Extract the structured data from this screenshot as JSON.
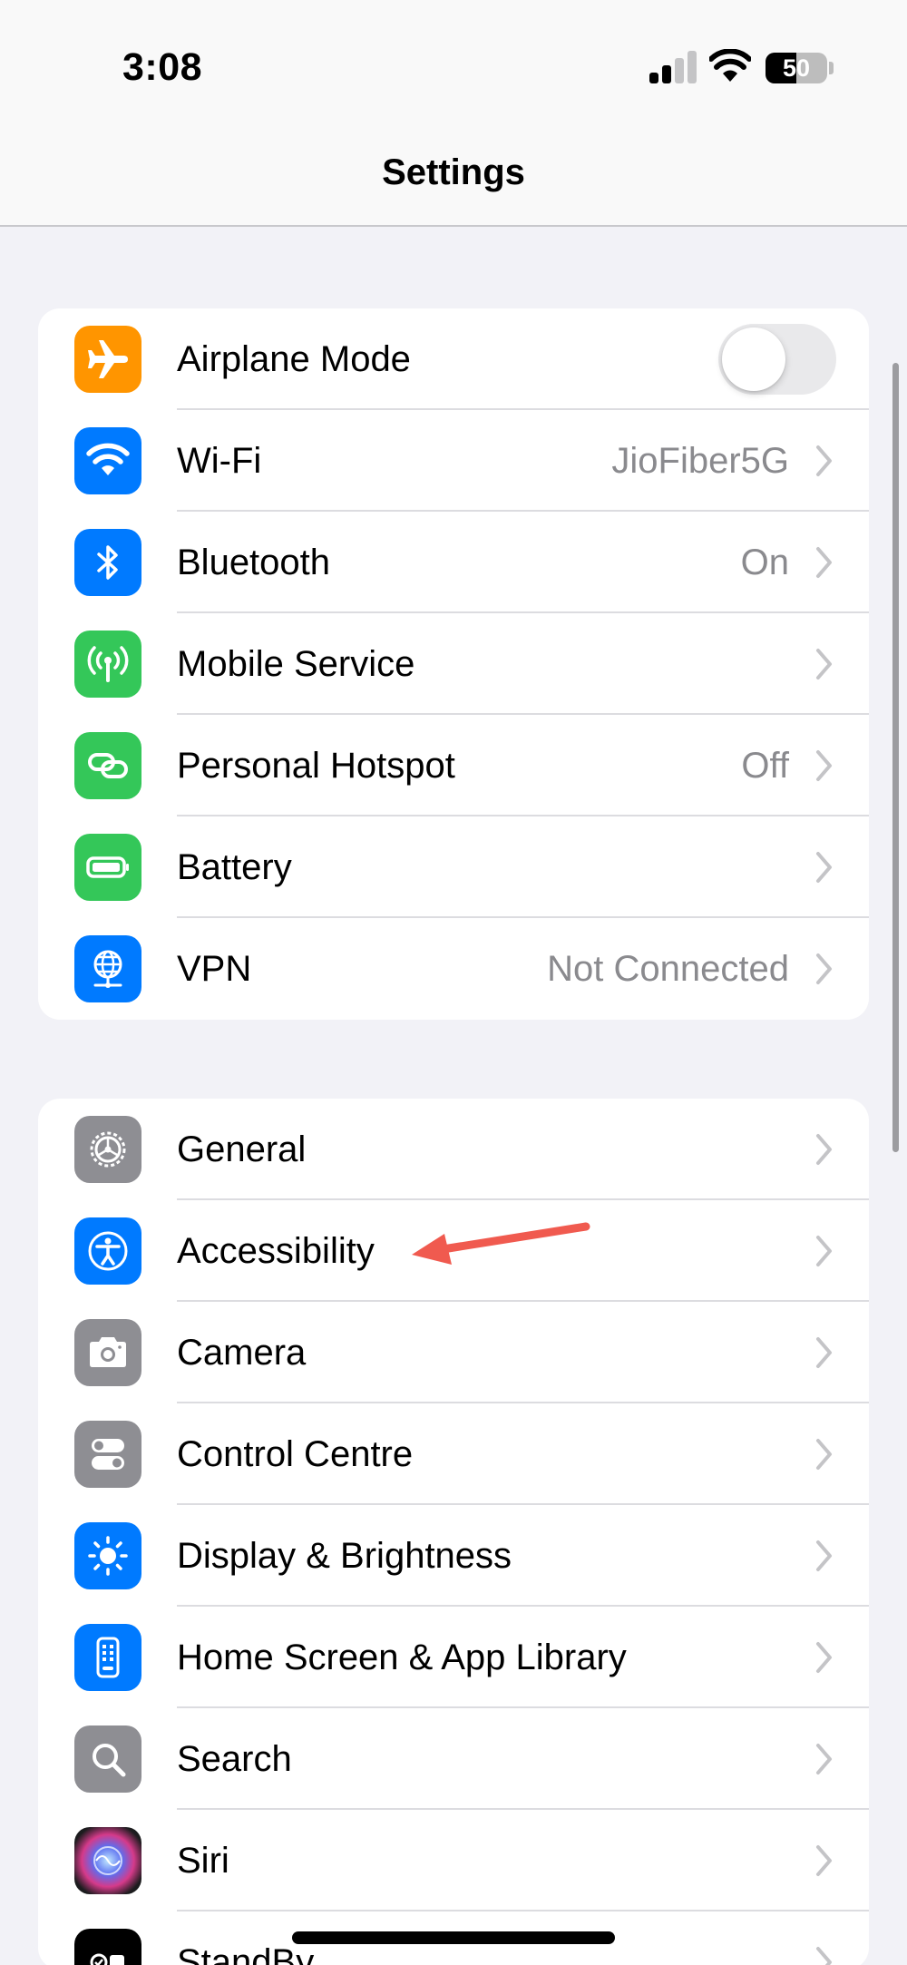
{
  "status_bar": {
    "time": "3:08",
    "battery_percent": "50",
    "battery_level": 0.5,
    "icons": [
      "cellular-signal-icon",
      "wifi-icon",
      "battery-icon"
    ]
  },
  "nav": {
    "title": "Settings"
  },
  "group1": {
    "airplane": {
      "label": "Airplane Mode",
      "toggle_on": false,
      "icon": "airplane-icon",
      "color": "#ff9500"
    },
    "wifi": {
      "label": "Wi-Fi",
      "value": "JioFiber5G",
      "icon": "wifi-icon",
      "color": "#007aff"
    },
    "bluetooth": {
      "label": "Bluetooth",
      "value": "On",
      "icon": "bluetooth-icon",
      "color": "#007aff"
    },
    "mobile": {
      "label": "Mobile Service",
      "icon": "antenna-icon",
      "color": "#34c759"
    },
    "hotspot": {
      "label": "Personal Hotspot",
      "value": "Off",
      "icon": "link-icon",
      "color": "#34c759"
    },
    "battery": {
      "label": "Battery",
      "icon": "battery-icon",
      "color": "#34c759"
    },
    "vpn": {
      "label": "VPN",
      "value": "Not Connected",
      "icon": "globe-icon",
      "color": "#007aff"
    }
  },
  "group2": {
    "general": {
      "label": "General",
      "icon": "gear-icon",
      "color": "#8e8e93"
    },
    "accessibility": {
      "label": "Accessibility",
      "icon": "accessibility-icon",
      "color": "#007aff"
    },
    "camera": {
      "label": "Camera",
      "icon": "camera-icon",
      "color": "#8e8e93"
    },
    "control_centre": {
      "label": "Control Centre",
      "icon": "switches-icon",
      "color": "#8e8e93"
    },
    "display": {
      "label": "Display & Brightness",
      "icon": "sun-icon",
      "color": "#007aff"
    },
    "home_screen": {
      "label": "Home Screen & App Library",
      "icon": "phone-grid-icon",
      "color": "#007aff"
    },
    "search": {
      "label": "Search",
      "icon": "magnifier-icon",
      "color": "#8e8e93"
    },
    "siri": {
      "label": "Siri",
      "icon": "siri-icon",
      "color": "#1c1c1e"
    },
    "standby": {
      "label": "StandBy",
      "icon": "standby-icon",
      "color": "#000000"
    }
  },
  "annotation": {
    "color": "#f05a4f",
    "target": "Accessibility"
  }
}
